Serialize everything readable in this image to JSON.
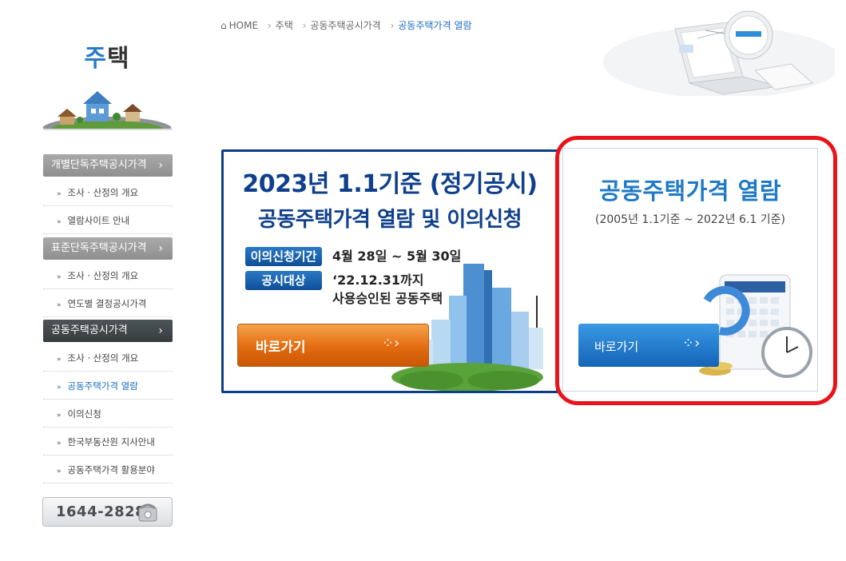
{
  "sidebar": {
    "title_accent": "주",
    "title_rest": "택",
    "sections": [
      {
        "label": "개별단독주택공시가격",
        "items": [
          "조사 · 산정의 개요",
          "열람사이트 안내"
        ]
      },
      {
        "label": "표준단독주택공시가격",
        "items": [
          "조사 · 산정의 개요",
          "연도별 결정공시가격"
        ]
      },
      {
        "label": "공동주택공시가격",
        "items": [
          "조사 · 산정의 개요",
          "공동주택가격 열람",
          "이의신청",
          "한국부동산원 지사안내",
          "공동주택가격 활용분야"
        ]
      }
    ],
    "arrow": "›",
    "bullet": "»",
    "phone": "1644-2828"
  },
  "breadcrumb": {
    "items": [
      "HOME",
      "주택",
      "공동주택공시가격",
      "공동주택가격 열람"
    ],
    "sep": "›"
  },
  "banner_left": {
    "title": "2023년 1.1기준 (정기공시)",
    "subtitle": "공동주택가격 열람 및 이의신청",
    "tag1": "이의신청기간",
    "tag1_value": "4월 28일 ~ 5월 30일",
    "tag2": "공시대상",
    "tag2_value_line1": "‘22.12.31까지",
    "tag2_value_line2": "사용승인된 공동주택",
    "button": "바로가기"
  },
  "banner_right": {
    "title": "공동주택가격 열람",
    "subtitle": "(2005년 1.1기준 ~ 2022년 6.1 기준)",
    "button": "바로가기"
  },
  "colors": {
    "accent_blue": "#1e79c6",
    "navy": "#0f3f8c",
    "orange": "#e36b0f",
    "highlight_red": "#e8141c"
  }
}
